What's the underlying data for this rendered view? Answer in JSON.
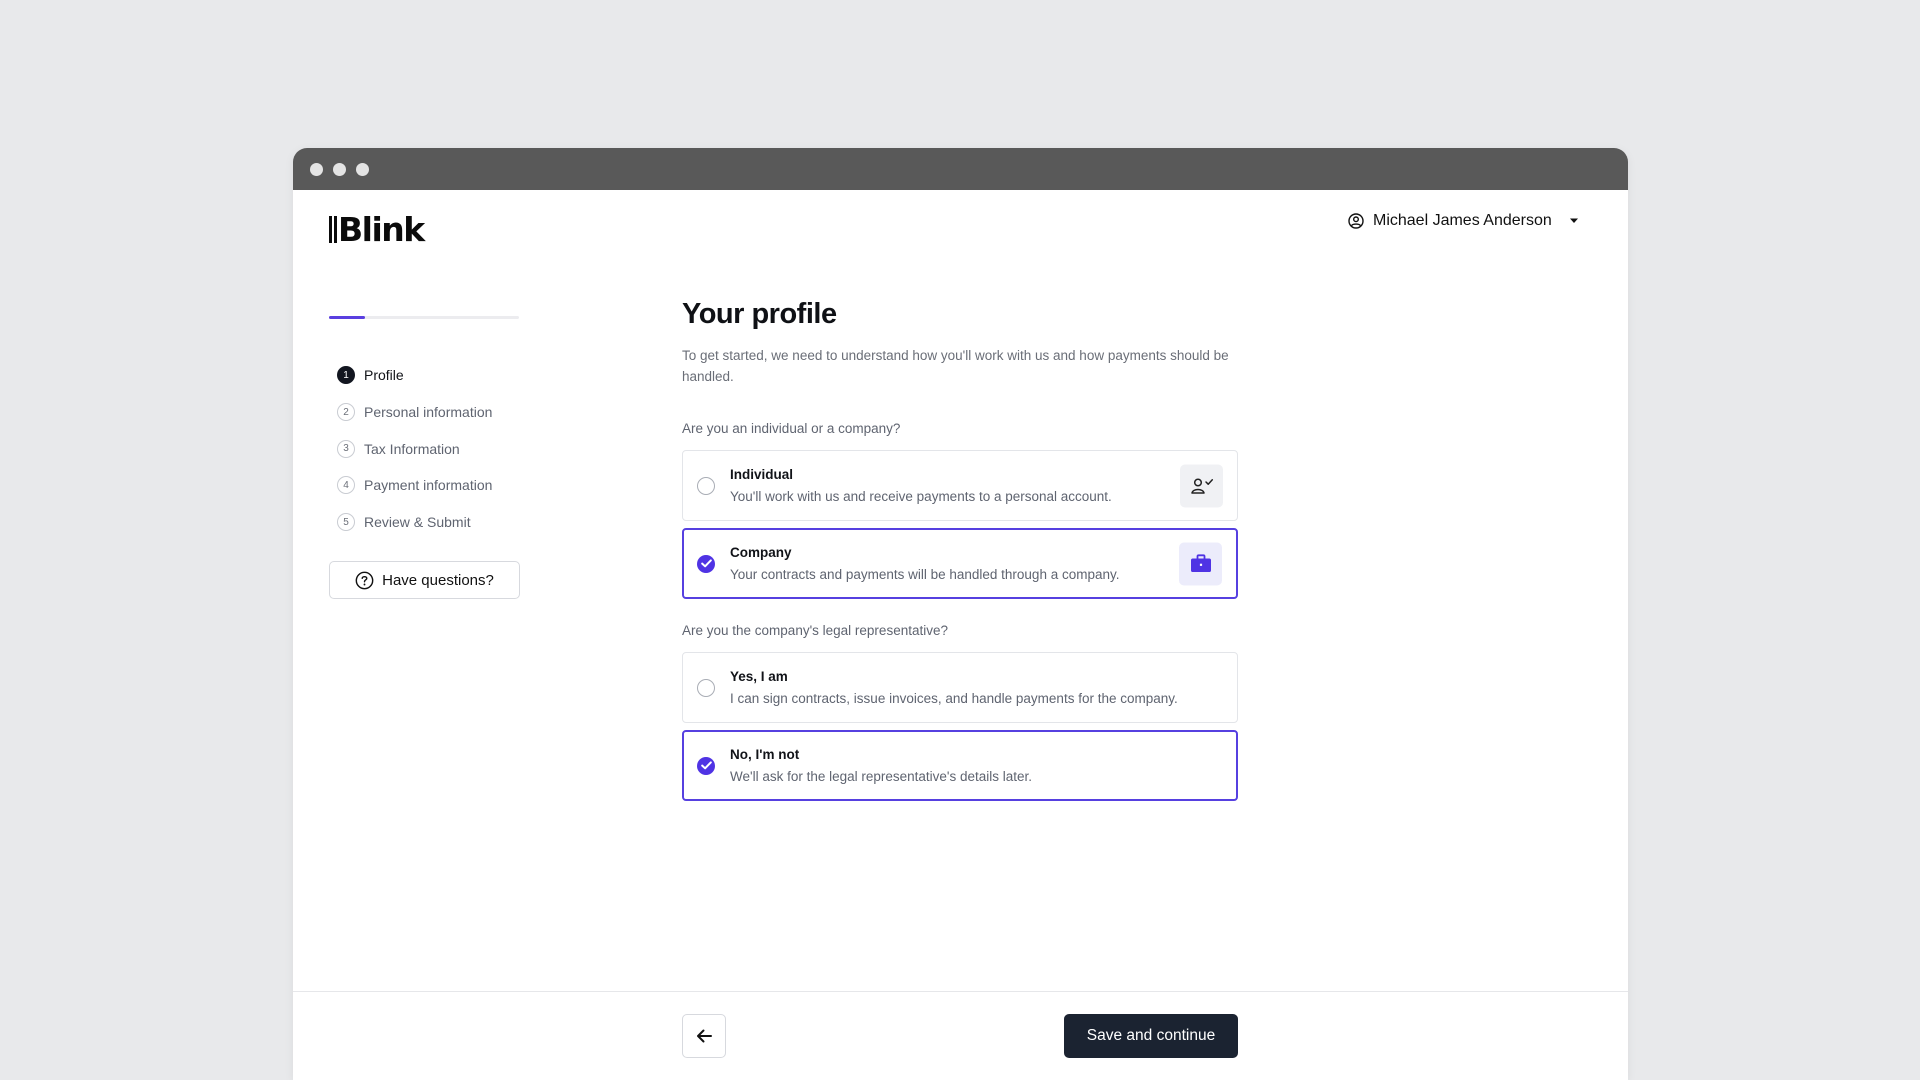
{
  "app": {
    "brand": "Blink"
  },
  "user": {
    "name": "Michael James Anderson"
  },
  "progress": {
    "fraction": 0.19
  },
  "steps": [
    {
      "number": "1",
      "label": "Profile",
      "active": true
    },
    {
      "number": "2",
      "label": "Personal information",
      "active": false
    },
    {
      "number": "3",
      "label": "Tax Information",
      "active": false
    },
    {
      "number": "4",
      "label": "Payment information",
      "active": false
    },
    {
      "number": "5",
      "label": "Review & Submit",
      "active": false
    }
  ],
  "help": {
    "label": "Have questions?"
  },
  "page": {
    "title": "Your profile",
    "subtitle": "To get started, we need to understand how you'll work with us and how payments should be handled."
  },
  "q1": {
    "label": "Are you an individual or a company?",
    "options": [
      {
        "title": "Individual",
        "desc": "You'll work with us and receive payments to a personal account.",
        "selected": false,
        "icon": "user-check-icon"
      },
      {
        "title": "Company",
        "desc": "Your contracts and payments will be handled through a company.",
        "selected": true,
        "icon": "briefcase-icon"
      }
    ]
  },
  "q2": {
    "label": "Are you the company's legal representative?",
    "options": [
      {
        "title": "Yes, I am",
        "desc": "I can sign contracts, issue invoices, and handle payments for the company.",
        "selected": false
      },
      {
        "title": "No, I'm not",
        "desc": "We'll ask for the legal representative's details later.",
        "selected": true
      }
    ]
  },
  "footer": {
    "primary_label": "Save and continue",
    "back_icon": "arrow-left-icon"
  },
  "colors": {
    "accent": "#5640e0",
    "primary_button": "#1b2331",
    "titlebar": "#595959",
    "background": "#e8e9eb"
  }
}
